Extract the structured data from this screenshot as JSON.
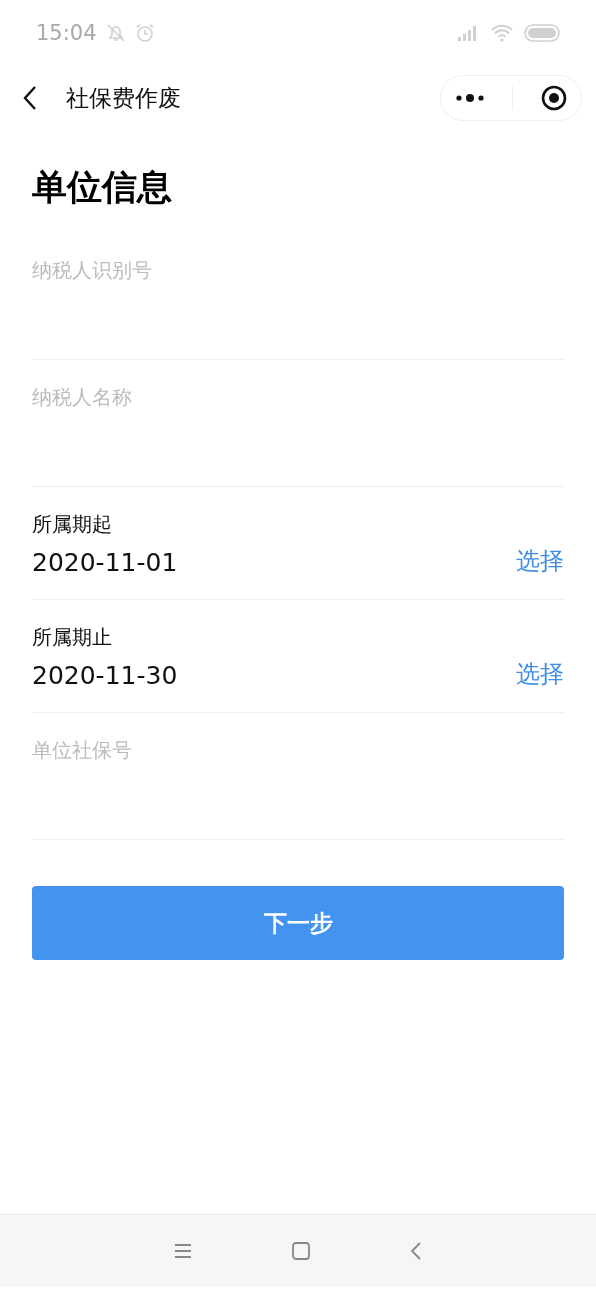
{
  "status_bar": {
    "time": "15:04"
  },
  "nav": {
    "title": "社保费作废"
  },
  "heading": "单位信息",
  "fields": [
    {
      "kind": "input",
      "placeholder": "纳税人识别号"
    },
    {
      "kind": "input",
      "placeholder": "纳税人名称"
    },
    {
      "kind": "date",
      "label": "所属期起",
      "value": "2020-11-01",
      "action": "选择"
    },
    {
      "kind": "date",
      "label": "所属期止",
      "value": "2020-11-30",
      "action": "选择"
    },
    {
      "kind": "input",
      "placeholder": "单位社保号"
    }
  ],
  "button": "下一步"
}
